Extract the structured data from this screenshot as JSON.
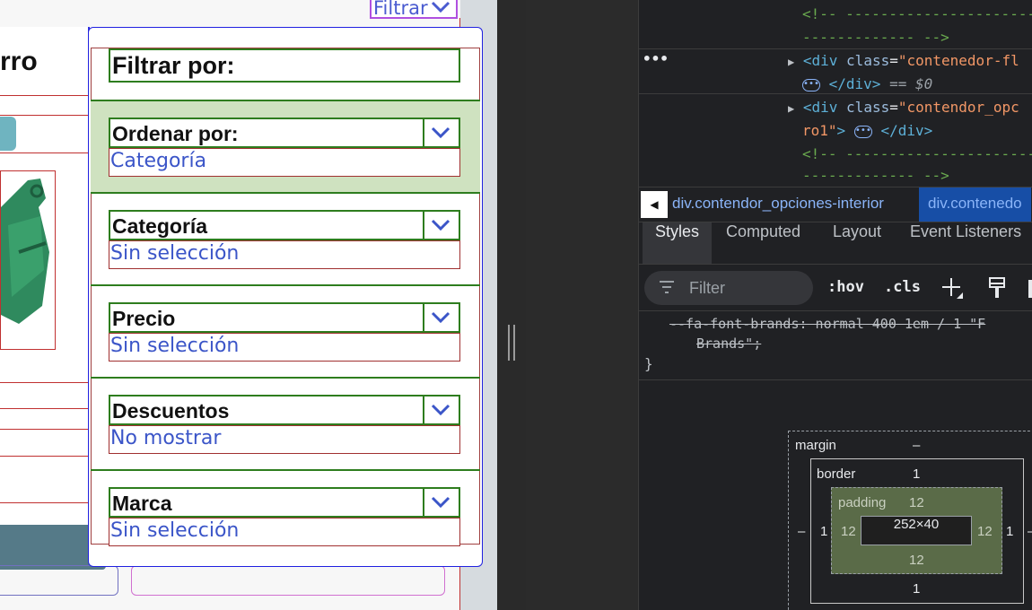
{
  "page": {
    "top_filter_label": "Filtrar",
    "back_title": "rro"
  },
  "modal": {
    "title": "Filtrar por:",
    "sections": [
      {
        "label": "Ordenar por:",
        "value": "Categoría"
      },
      {
        "label": "Categoría",
        "value": "Sin selección"
      },
      {
        "label": "Precio",
        "value": "Sin selección"
      },
      {
        "label": "Descuentos",
        "value": "No mostrar"
      },
      {
        "label": "Marca",
        "value": "Sin selección"
      }
    ]
  },
  "devtools": {
    "code": {
      "comment_open": "<!-- ----------------------",
      "comment_close": "------------- -->",
      "line1_tag": "<div",
      "line1_attr": "class",
      "line1_val": "\"contenedor-fl",
      "line2_suffix": "</div>",
      "line2_eq": "== $0",
      "line3_tag": "<div",
      "line3_attr": "class",
      "line3_val": "\"contendor_opc",
      "line4_val": "ro1\"",
      "line4_tail": "</div>",
      "comment2_open": "<!-- ----------------------",
      "comment2_close": "------------- -->"
    },
    "breadcrumbs": [
      "div.contendor_opciones-interior",
      "div.contenedo"
    ],
    "tabs": [
      "Styles",
      "Computed",
      "Layout",
      "Event Listeners"
    ],
    "active_tab": "Styles",
    "filter_placeholder": "Filter",
    "hov_label": ":hov",
    "cls_label": ".cls",
    "css_line1": "--fa-font-brands: normal 400 1em / 1 \"F",
    "css_line2": "Brands\";",
    "css_close": "}",
    "box_model": {
      "margin_label": "margin",
      "margin_value": "–",
      "margin_left": "–",
      "margin_right": "–",
      "border_label": "border",
      "border_top": "1",
      "border_bottom": "1",
      "border_left": "1",
      "border_right": "1",
      "padding_label": "padding",
      "padding_top": "12",
      "padding_bottom": "12",
      "padding_left": "12",
      "padding_right": "12",
      "content": "252×40"
    }
  }
}
